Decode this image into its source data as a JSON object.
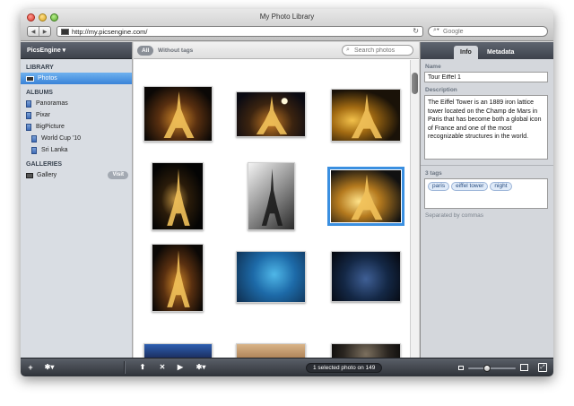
{
  "window": {
    "title": "My Photo Library"
  },
  "browser": {
    "url": "http://my.picsengine.com/",
    "search_placeholder": "Google"
  },
  "sidebar": {
    "app_menu_label": "PicsEngine ▾",
    "sections": {
      "library": "LIBRARY",
      "albums": "ALBUMS",
      "galleries": "GALLERIES"
    },
    "library_items": [
      {
        "label": "Photos",
        "selected": true
      }
    ],
    "album_items": [
      {
        "label": "Panoramas",
        "level": 0
      },
      {
        "label": "Pixar",
        "level": 0
      },
      {
        "label": "BigPicture",
        "level": 0
      },
      {
        "label": "World Cup '10",
        "level": 1
      },
      {
        "label": "Sri Lanka",
        "level": 1
      }
    ],
    "gallery_items": [
      {
        "label": "Gallery",
        "action": "Visit"
      }
    ]
  },
  "filter": {
    "all_label": "All",
    "without_tags_label": "Without tags",
    "search_placeholder": "Search photos"
  },
  "photos": [
    {
      "kind": "eiffel-night-warm"
    },
    {
      "kind": "eiffel-moon"
    },
    {
      "kind": "eiffel-fountain"
    },
    {
      "kind": "eiffel-dark"
    },
    {
      "kind": "eiffel-bw"
    },
    {
      "kind": "eiffel-sparkle",
      "selected": true
    },
    {
      "kind": "eiffel-night-warm"
    },
    {
      "kind": "monster-blue"
    },
    {
      "kind": "monster-dark"
    },
    {
      "kind": "toy-blue"
    },
    {
      "kind": "warm-room"
    },
    {
      "kind": "robot-dark"
    }
  ],
  "inspector": {
    "tabs": [
      "Info",
      "Metadata"
    ],
    "active_tab": "Info",
    "name_label": "Name",
    "name_value": "Tour Eiffel 1",
    "description_label": "Description",
    "description_value": "The Eiffel Tower is an 1889 iron lattice tower located on the Champ de Mars in Paris that has become both a global icon of France and one of the most recognizable structures in the world.",
    "tags_label": "3 tags",
    "tags": [
      "paris",
      "eiffel tower",
      "night"
    ],
    "tags_hint": "Separated by commas"
  },
  "bottombar": {
    "status_text": "1 selected photo on 149",
    "zoom_level": 0.4
  },
  "colors": {
    "selection_blue": "#3a8fe0",
    "sidebar_bg": "#d9dde3",
    "dark_bar": "#3d424b"
  }
}
